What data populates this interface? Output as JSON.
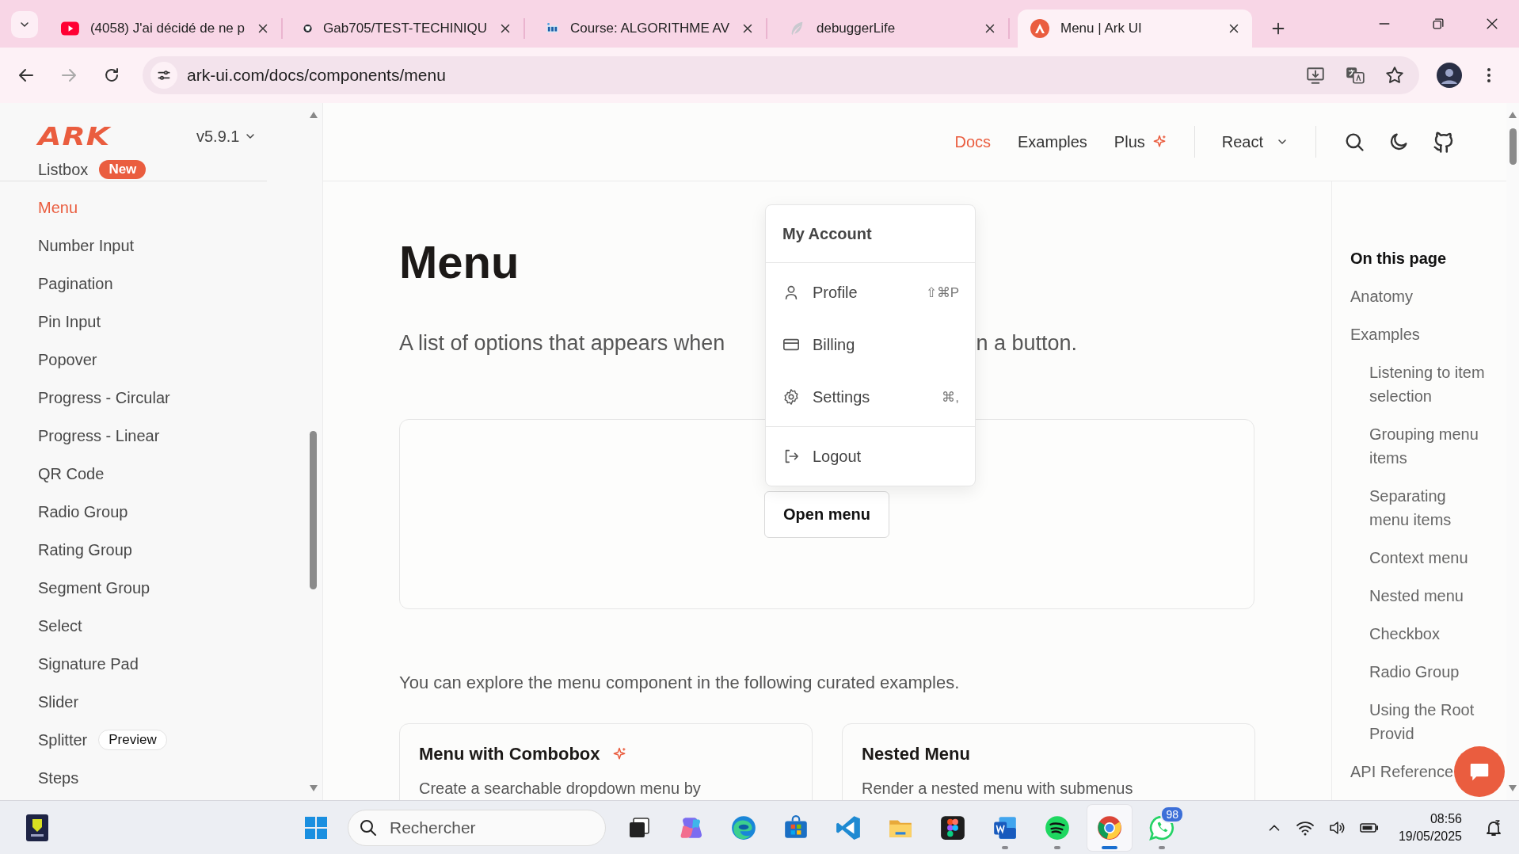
{
  "browser": {
    "tabs": [
      {
        "kind": "youtube",
        "title": "(4058) J'ai décidé de ne p",
        "selected": false
      },
      {
        "kind": "github",
        "title": "Gab705/TEST-TECHINIQU",
        "selected": false
      },
      {
        "kind": "course",
        "title": "Course: ALGORITHME AV",
        "selected": false
      },
      {
        "kind": "feather",
        "title": "debuggerLife",
        "selected": false
      },
      {
        "kind": "ark",
        "title": "Menu | Ark UI",
        "selected": true
      }
    ],
    "url": "ark-ui.com/docs/components/menu"
  },
  "sidebar": {
    "logo": "ARK",
    "version": "v5.9.1",
    "items": [
      {
        "label": "Listbox",
        "selected": false,
        "badge": {
          "kind": "new",
          "text": "New"
        }
      },
      {
        "label": "Menu",
        "selected": true
      },
      {
        "label": "Number Input",
        "selected": false
      },
      {
        "label": "Pagination",
        "selected": false
      },
      {
        "label": "Pin Input",
        "selected": false
      },
      {
        "label": "Popover",
        "selected": false
      },
      {
        "label": "Progress - Circular",
        "selected": false
      },
      {
        "label": "Progress - Linear",
        "selected": false
      },
      {
        "label": "QR Code",
        "selected": false
      },
      {
        "label": "Radio Group",
        "selected": false
      },
      {
        "label": "Rating Group",
        "selected": false
      },
      {
        "label": "Segment Group",
        "selected": false
      },
      {
        "label": "Select",
        "selected": false
      },
      {
        "label": "Signature Pad",
        "selected": false
      },
      {
        "label": "Slider",
        "selected": false
      },
      {
        "label": "Splitter",
        "selected": false,
        "badge": {
          "kind": "preview",
          "text": "Preview"
        }
      },
      {
        "label": "Steps",
        "selected": false
      }
    ]
  },
  "header": {
    "nav": [
      {
        "label": "Docs",
        "selected": true,
        "plus": false
      },
      {
        "label": "Examples",
        "selected": false,
        "plus": false
      },
      {
        "label": "Plus",
        "selected": false,
        "plus": true
      }
    ],
    "framework": "React"
  },
  "main": {
    "title": "Menu",
    "description_before": "A list of options that appears when",
    "description_after": "n a button.",
    "demo": {
      "button": "Open menu",
      "menu": {
        "heading": "My Account",
        "groups": [
          {
            "items": [
              {
                "kind": "person",
                "label": "Profile",
                "shortcut": "⇧⌘P"
              },
              {
                "kind": "card",
                "label": "Billing"
              },
              {
                "kind": "gear",
                "label": "Settings",
                "shortcut": "⌘,"
              }
            ]
          },
          {
            "items": [
              {
                "kind": "logout",
                "label": "Logout"
              }
            ]
          }
        ]
      }
    },
    "intro": "You can explore the menu component in the following curated examples.",
    "examples": [
      {
        "title": "Menu with Combobox",
        "plus": true,
        "description": "Create a searchable dropdown menu by"
      },
      {
        "title": "Nested Menu",
        "plus": false,
        "description": "Render a nested menu with submenus"
      }
    ]
  },
  "toc": {
    "heading": "On this page",
    "items": [
      {
        "label": "Anatomy"
      },
      {
        "label": "Examples",
        "children": [
          {
            "label": "Listening to item selection"
          },
          {
            "label": "Grouping menu items"
          },
          {
            "label": "Separating menu items"
          },
          {
            "label": "Context menu"
          },
          {
            "label": "Nested menu"
          },
          {
            "label": "Checkbox"
          },
          {
            "label": "Radio Group"
          },
          {
            "label": "Using the Root Provid"
          }
        ]
      },
      {
        "label": "API Reference"
      }
    ]
  },
  "taskbar": {
    "search_placeholder": "Rechercher",
    "apps": [
      {
        "kind": "taskview",
        "running": false,
        "selected": false
      },
      {
        "kind": "copilot",
        "running": false,
        "selected": false
      },
      {
        "kind": "edge",
        "running": false,
        "selected": false
      },
      {
        "kind": "store",
        "running": false,
        "selected": false
      },
      {
        "kind": "vscode",
        "running": false,
        "selected": false
      },
      {
        "kind": "files",
        "running": false,
        "selected": false
      },
      {
        "kind": "figma",
        "running": false,
        "selected": false
      },
      {
        "kind": "word",
        "running": true,
        "selected": false
      },
      {
        "kind": "spotify",
        "running": true,
        "selected": false
      },
      {
        "kind": "chrome",
        "running": true,
        "selected": true
      },
      {
        "kind": "whatsapp",
        "running": true,
        "selected": false,
        "badge": "98"
      }
    ],
    "time": "08:56",
    "date": "19/05/2025"
  }
}
